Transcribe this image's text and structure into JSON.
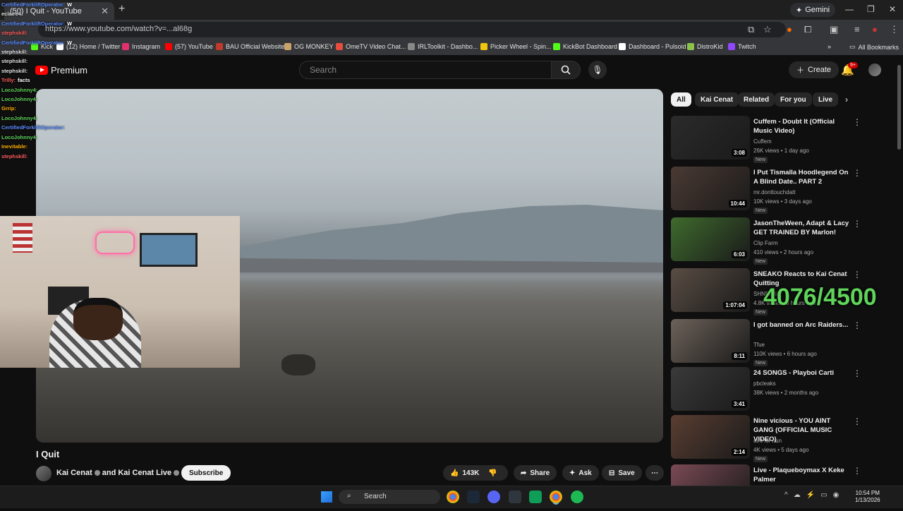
{
  "browser": {
    "tab_title": "(50) I Quit - YouTube",
    "url_text": "https://www.youtube.com/watch?v=...al68g",
    "gemini_label": "Gemini",
    "all_bookmarks_label": "All Bookmarks",
    "bookmarks": [
      {
        "label": "Kick",
        "color": "#53fc18"
      },
      {
        "label": "(12) Home / Twitter",
        "color": "#ffffff"
      },
      {
        "label": "Instagram",
        "color": "#e1306c"
      },
      {
        "label": "(57) YouTube",
        "color": "#ff0000"
      },
      {
        "label": "BAU Official Website",
        "color": "#c0392b"
      },
      {
        "label": "OG MONKEY",
        "color": "#caa36b"
      },
      {
        "label": "OmeTV Video Chat...",
        "color": "#e74c3c"
      },
      {
        "label": "IRLToolkit - Dashbo...",
        "color": "#888888"
      },
      {
        "label": "Picker Wheel - Spin...",
        "color": "#f1c40f"
      },
      {
        "label": "KickBot Dashboard",
        "color": "#53fc18"
      },
      {
        "label": "Dashboard - Pulsoid",
        "color": "#ffffff"
      },
      {
        "label": "DistroKid",
        "color": "#8bc34a"
      },
      {
        "label": "Twitch",
        "color": "#9146ff"
      }
    ]
  },
  "youtube": {
    "logo_text": "Premium",
    "search_placeholder": "Search",
    "create_label": "Create",
    "notification_count": "9+"
  },
  "chat": [
    {
      "user": "CertifiedForkliftOperator:",
      "msg": "W",
      "color": "#5b8cff"
    },
    {
      "user": "eclaire4:",
      "msg": "",
      "color": "#e0e0e0"
    },
    {
      "user": "CertifiedForkliftOperator:",
      "msg": "W",
      "color": "#5b8cff"
    },
    {
      "user": "stephskill:",
      "msg": "",
      "color": "#ff5f5f"
    },
    {
      "user": "CertifiedForkliftOperator:",
      "msg": "W",
      "color": "#5b8cff"
    },
    {
      "user": "stephskill:",
      "msg": "",
      "color": "#e0e0e0"
    },
    {
      "user": "stephskill:",
      "msg": "",
      "color": "#e0e0e0"
    },
    {
      "user": "stephskill:",
      "msg": "",
      "color": "#e0e0e0"
    },
    {
      "user": "Trilly:",
      "msg": "facts",
      "color": "#ff5f5f"
    },
    {
      "user": "LocoJohnny4:",
      "msg": "",
      "color": "#5fd35a"
    },
    {
      "user": "LocoJohnny4:",
      "msg": "",
      "color": "#5fd35a"
    },
    {
      "user": "Grrip:",
      "msg": "",
      "color": "#ffb000"
    },
    {
      "user": "LocoJohnny4:",
      "msg": "",
      "color": "#5fd35a"
    },
    {
      "user": "CertifiedForkliftOperator:",
      "msg": "",
      "color": "#5b8cff"
    },
    {
      "user": "LocoJohnny4:",
      "msg": "",
      "color": "#5fd35a"
    },
    {
      "user": "Inevitable:",
      "msg": "",
      "color": "#ffb000"
    },
    {
      "user": "stephskill:",
      "msg": "",
      "color": "#ff5f5f"
    }
  ],
  "video": {
    "title": "I Quit",
    "channels": "Kai Cenat",
    "channels_and": "and Kai Cenat Live",
    "subscribe_label": "Subscribe",
    "likes": "143K",
    "share_label": "Share",
    "ask_label": "Ask",
    "save_label": "Save"
  },
  "chips": [
    "All",
    "Kai Cenat",
    "Related",
    "For you",
    "Live"
  ],
  "recommendations": [
    {
      "title": "Cuffem - Doubt It (Official Music Video)",
      "channel": "Cuffem",
      "meta": "26K views • 1 day ago",
      "duration": "3:08",
      "badge": "New",
      "thumb": "#2b2b2b"
    },
    {
      "title": "I Put Tismalla Hoodlegend On A Blind Date.. PART 2",
      "channel": "mr.donttouchdatt",
      "meta": "10K views • 3 days ago",
      "duration": "10:44",
      "badge": "New",
      "thumb": "#4a3a33"
    },
    {
      "title": "JasonTheWeen, Adapt & Lacy GET TRAINED BY Marlon!",
      "channel": "Clip Farm",
      "meta": "410 views • 2 hours ago",
      "duration": "6:03",
      "badge": "New",
      "thumb": "#3f6b2d"
    },
    {
      "title": "SNEAKO Reacts to Kai Cenat Quitting",
      "channel": "SHNEAKO",
      "meta": "4.8K views • 3 hours ago",
      "duration": "1:07:04",
      "badge": "New",
      "thumb": "#5a4d44"
    },
    {
      "title": "I got banned on Arc Raiders...",
      "channel": "Tfue",
      "meta": "110K views • 6 hours ago",
      "duration": "8:11",
      "badge": "New",
      "thumb": "#6d625a"
    },
    {
      "title": "24 SONGS - Playboi Carti",
      "channel": "pbcleaks",
      "meta": "38K views • 2 months ago",
      "duration": "3:41",
      "badge": "",
      "thumb": "#3a3a3a"
    },
    {
      "title": "Nine vicious - YOU AINT GANG (OFFICIAL MUSIC VIDEO)",
      "channel": "aint for nun",
      "meta": "4K views • 5 days ago",
      "duration": "2:14",
      "badge": "New",
      "thumb": "#5a3e32"
    },
    {
      "title": "Live - Plaqueboymax X Keke Palmer",
      "channel": "",
      "meta": "",
      "duration": "",
      "badge": "",
      "thumb": "#7a4a55"
    }
  ],
  "overlay_counter": "4076/4500",
  "taskbar": {
    "search_label": "Search",
    "time": "10:54 PM",
    "date": "1/13/2026"
  }
}
